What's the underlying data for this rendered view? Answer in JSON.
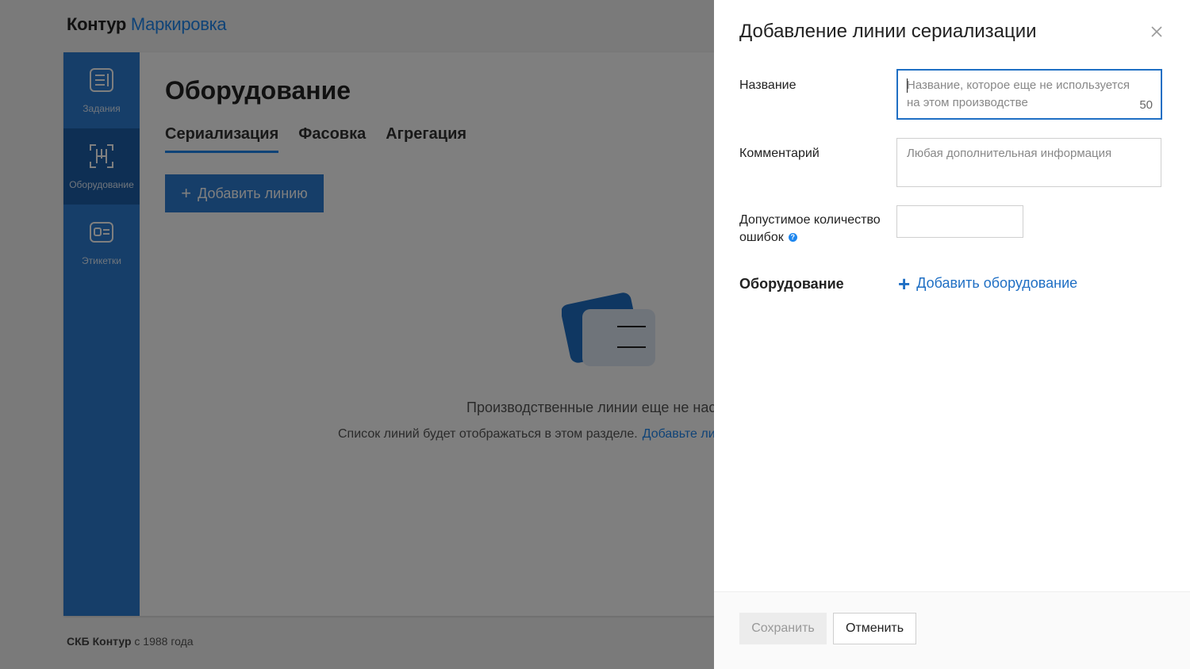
{
  "header": {
    "brand": "Контур",
    "product": "Маркировка"
  },
  "sidebar": {
    "items": [
      {
        "label": "Задания",
        "icon": "tasks-icon"
      },
      {
        "label": "Оборудование",
        "icon": "equipment-icon",
        "active": true
      },
      {
        "label": "Этикетки",
        "icon": "labels-icon"
      }
    ]
  },
  "main": {
    "title": "Оборудование",
    "tabs": [
      {
        "label": "Сериализация",
        "active": true
      },
      {
        "label": "Фасовка"
      },
      {
        "label": "Агрегация"
      }
    ],
    "add_line_button": "Добавить линию",
    "empty_state": {
      "title": "Производственные линии еще не настроены",
      "text": "Список линий будет отображаться в этом разделе.",
      "link": "Добавьте линию"
    }
  },
  "footer": {
    "company": "СКБ Контур",
    "since": "с 1988 года"
  },
  "panel": {
    "title": "Добавление линии сериализации",
    "name_label": "Название",
    "name_placeholder_line1": "Название, которое еще не используется",
    "name_placeholder_line2": "на этом производстве",
    "name_counter": "50",
    "comment_label": "Комментарий",
    "comment_placeholder": "Любая дополнительная информация",
    "errors_label_line1": "Допустимое количество",
    "errors_label_line2": "ошибок",
    "errors_help": "?",
    "equipment_title": "Оборудование",
    "add_equipment": "Добавить оборудование",
    "save_button": "Сохранить",
    "cancel_button": "Отменить"
  },
  "colors": {
    "accent": "#1f87ef",
    "sidebar": "#2d7dd2",
    "focus_border": "#1f6fc4"
  }
}
